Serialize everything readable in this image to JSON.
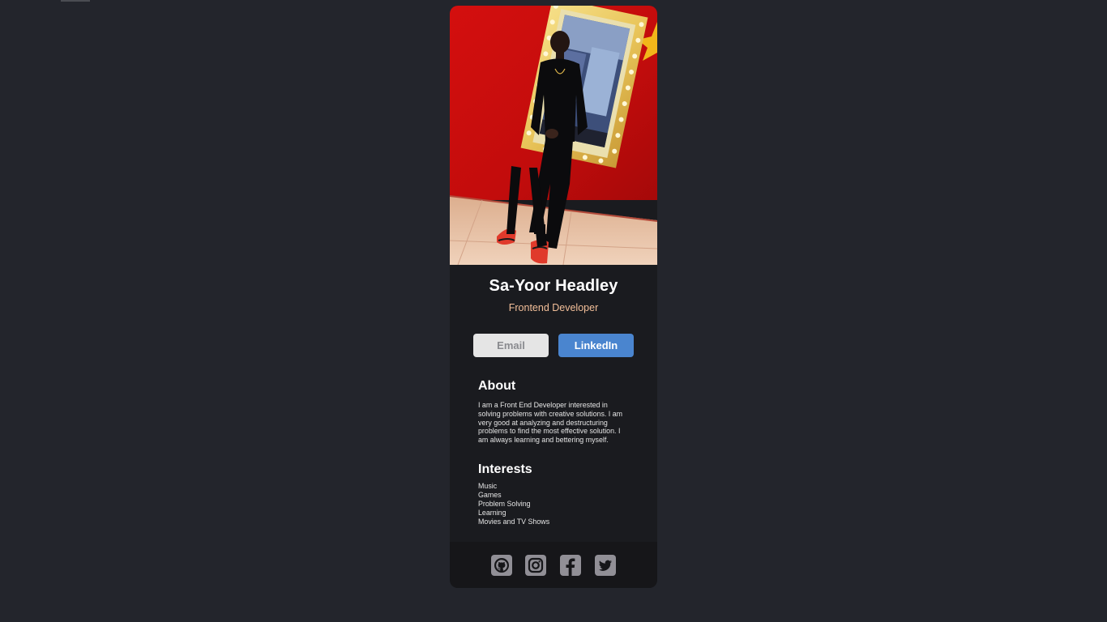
{
  "profile": {
    "name": "Sa-Yoor Headley",
    "role": "Frontend Developer"
  },
  "buttons": {
    "email_label": "Email",
    "linkedin_label": "LinkedIn"
  },
  "about": {
    "title": "About",
    "text": "I am a Front End Developer interested in solving problems with creative solutions. I am very good at analyzing and destructuring problems to find the most effective solution. I am always learning and bettering myself."
  },
  "interests": {
    "title": "Interests",
    "items": [
      "Music",
      "Games",
      "Problem Solving",
      "Learning",
      "Movies and TV Shows"
    ]
  },
  "social": {
    "icons": [
      "github-icon",
      "instagram-icon",
      "facebook-icon",
      "twitter-icon"
    ]
  },
  "colors": {
    "page_background": "#23252c",
    "card_background": "#1a1b1f",
    "footer_background": "#161619",
    "accent": "#f3bf99",
    "linkedin_blue": "#4a85cf",
    "email_button": "#e5e5e5",
    "icon_color": "#918f96"
  }
}
